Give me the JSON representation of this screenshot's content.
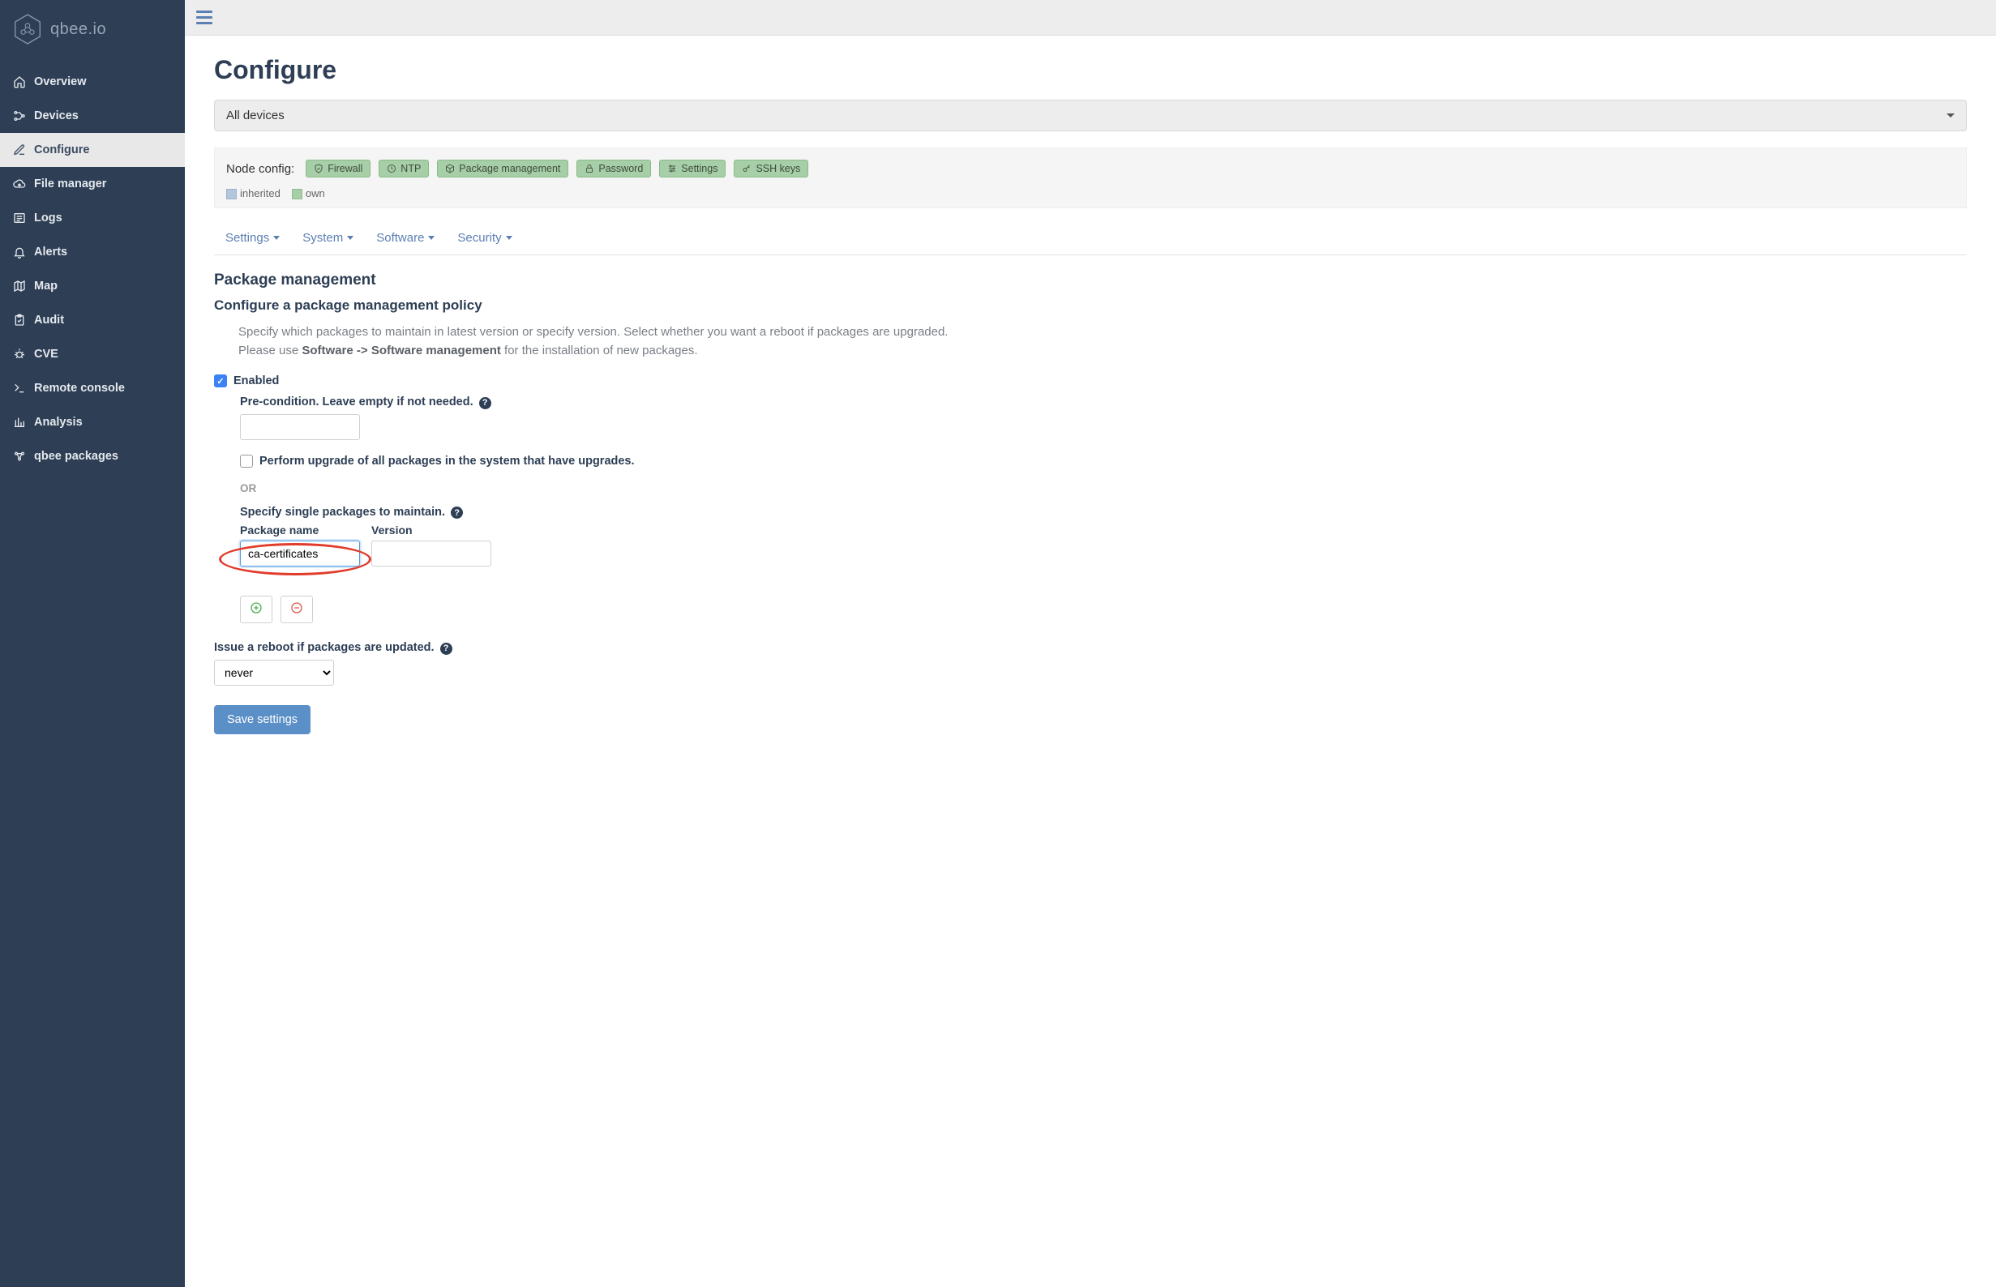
{
  "brand": "qbee.io",
  "sidebar": {
    "items": [
      {
        "label": "Overview",
        "name": "sidebar-item-overview"
      },
      {
        "label": "Devices",
        "name": "sidebar-item-devices"
      },
      {
        "label": "Configure",
        "name": "sidebar-item-configure",
        "active": true
      },
      {
        "label": "File manager",
        "name": "sidebar-item-file-manager"
      },
      {
        "label": "Logs",
        "name": "sidebar-item-logs"
      },
      {
        "label": "Alerts",
        "name": "sidebar-item-alerts"
      },
      {
        "label": "Map",
        "name": "sidebar-item-map"
      },
      {
        "label": "Audit",
        "name": "sidebar-item-audit"
      },
      {
        "label": "CVE",
        "name": "sidebar-item-cve"
      },
      {
        "label": "Remote console",
        "name": "sidebar-item-remote-console"
      },
      {
        "label": "Analysis",
        "name": "sidebar-item-analysis"
      },
      {
        "label": "qbee packages",
        "name": "sidebar-item-qbee-packages"
      }
    ]
  },
  "page": {
    "title": "Configure",
    "scope": "All devices",
    "node_config_label": "Node config:",
    "chips": [
      "Firewall",
      "NTP",
      "Package management",
      "Password",
      "Settings",
      "SSH keys"
    ],
    "legend": {
      "inherited": "inherited",
      "own": "own"
    },
    "tabs": [
      "Settings",
      "System",
      "Software",
      "Security"
    ],
    "section": {
      "title": "Package management",
      "subtitle": "Configure a package management policy",
      "desc_line1": "Specify which packages to maintain in latest version or specify version. Select whether you want a reboot if packages are upgraded.",
      "desc_line2a": "Please use ",
      "desc_line2b": "Software -> Software management",
      "desc_line2c": " for the installation of new packages."
    },
    "form": {
      "enabled_label": "Enabled",
      "precondition_label": "Pre-condition. Leave empty if not needed.",
      "precondition_value": "",
      "upgrade_all_label": "Perform upgrade of all packages in the system that have upgrades.",
      "or_label": "OR",
      "specify_label": "Specify single packages to maintain.",
      "package_name_label": "Package name",
      "version_label": "Version",
      "package_name_value": "ca-certificates",
      "version_value": "",
      "reboot_label": "Issue a reboot if packages are updated.",
      "reboot_value": "never",
      "save_label": "Save settings"
    }
  }
}
